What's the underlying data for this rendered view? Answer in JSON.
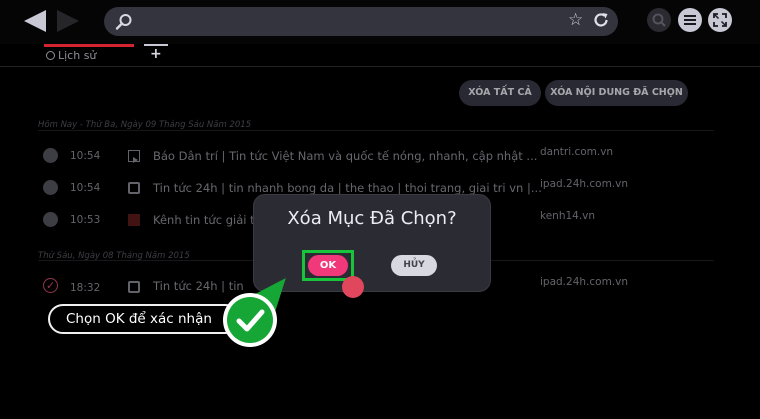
{
  "colors": {
    "accent_red": "#d4242f",
    "ok_pink": "#f0387a",
    "annotation_green": "#16a636"
  },
  "toolbar": {
    "back_icon": "back-arrow-icon",
    "forward_icon": "forward-arrow-icon",
    "search_icon": "search-icon",
    "star_icon": "star-icon",
    "reload_icon": "reload-icon",
    "zoom_icon": "zoom-icon",
    "menu_icon": "menu-icon",
    "fullscreen_icon": "fullscreen-icon"
  },
  "tabs": {
    "history_label": "Lịch sử",
    "add_label": "+"
  },
  "actions": {
    "delete_all": "XÓA TẤT CẢ",
    "delete_selected": "XÓA NỘI DUNG ĐÃ CHỌN"
  },
  "history": {
    "groups": [
      {
        "date": "Hôm Nay - Thứ Ba, Ngày 09 Tháng Sáu Năm 2015",
        "items": [
          {
            "time": "10:54",
            "title": "Báo Dân trí | Tin tức Việt Nam và quốc tế nóng, nhanh, cập nhật ...",
            "domain": "dantri.com.vn",
            "favicon": "dantri-favicon-icon"
          },
          {
            "time": "10:54",
            "title": "Tin tức 24h | tin nhanh bong da | the thao | thoi trang, giai tri vn |...",
            "domain": "ipad.24h.com.vn",
            "favicon": "24h-favicon-icon"
          },
          {
            "time": "10:53",
            "title": "Kênh tin tức giải trí",
            "domain": "kenh14.vn",
            "favicon": "kenh14-favicon-icon"
          }
        ]
      },
      {
        "date": "Thứ Sáu, Ngày 08 Tháng Năm 2015",
        "items": [
          {
            "time": "18:32",
            "title": "Tin tức 24h | tin",
            "domain": "ipad.24h.com.vn",
            "favicon": "24h-favicon-icon",
            "selected": true
          }
        ]
      }
    ]
  },
  "dialog": {
    "title": "Xóa Mục Đã Chọn?",
    "ok_label": "OK",
    "cancel_label": "HỦY"
  },
  "annotation": {
    "text": "Chọn OK để xác nhận",
    "badge_icon": "checkmark-icon"
  }
}
